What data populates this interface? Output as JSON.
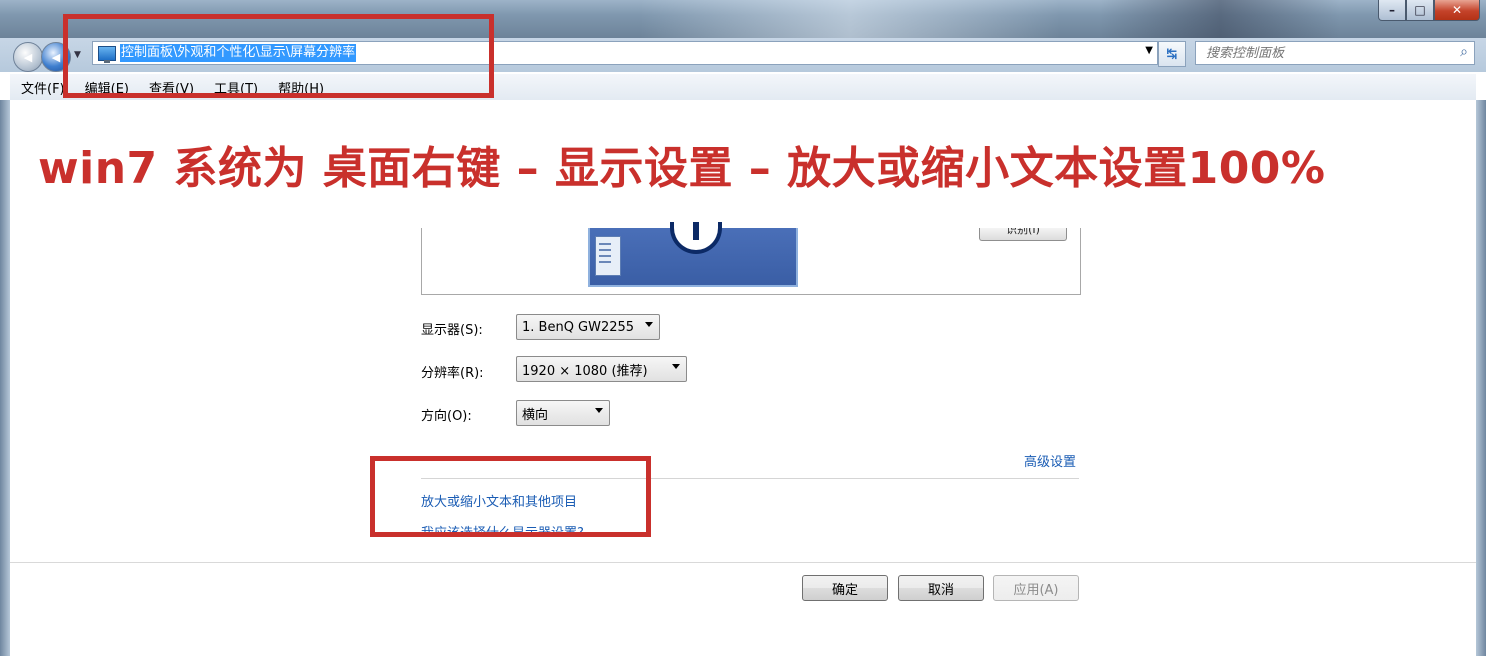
{
  "window": {
    "min_label": "–",
    "max_label": "□",
    "close_label": "✕"
  },
  "nav": {
    "back_label": "◀",
    "forward_label": "◀",
    "dropdown_label": "▼"
  },
  "address": {
    "path": "控制面板\\外观和个性化\\显示\\屏幕分辨率",
    "dropdown_label": "▼",
    "refresh_label": "↹"
  },
  "search": {
    "placeholder": "搜索控制面板",
    "icon": "search-icon"
  },
  "menu": {
    "items": [
      "文件(F)",
      "编辑(E)",
      "查看(V)",
      "工具(T)",
      "帮助(H)"
    ]
  },
  "annotation": {
    "banner": "win7 系统为 桌面右键 – 显示设置 – 放大或缩小文本设置100%",
    "color": "#c9302c"
  },
  "preview": {
    "identify_label": "识别(I)"
  },
  "form": {
    "display_label": "显示器(S):",
    "display_value": "1. BenQ GW2255",
    "resolution_label": "分辨率(R):",
    "resolution_value": "1920 × 1080 (推荐)",
    "orientation_label": "方向(O):",
    "orientation_value": "横向"
  },
  "links": {
    "advanced": "高级设置",
    "zoom_text": "放大或缩小文本和其他项目",
    "which_settings": "我应该选择什么显示器设置?"
  },
  "buttons": {
    "ok": "确定",
    "cancel": "取消",
    "apply": "应用(A)"
  },
  "colors": {
    "link": "#1a5cb4",
    "address_highlight": "#3399ff"
  }
}
